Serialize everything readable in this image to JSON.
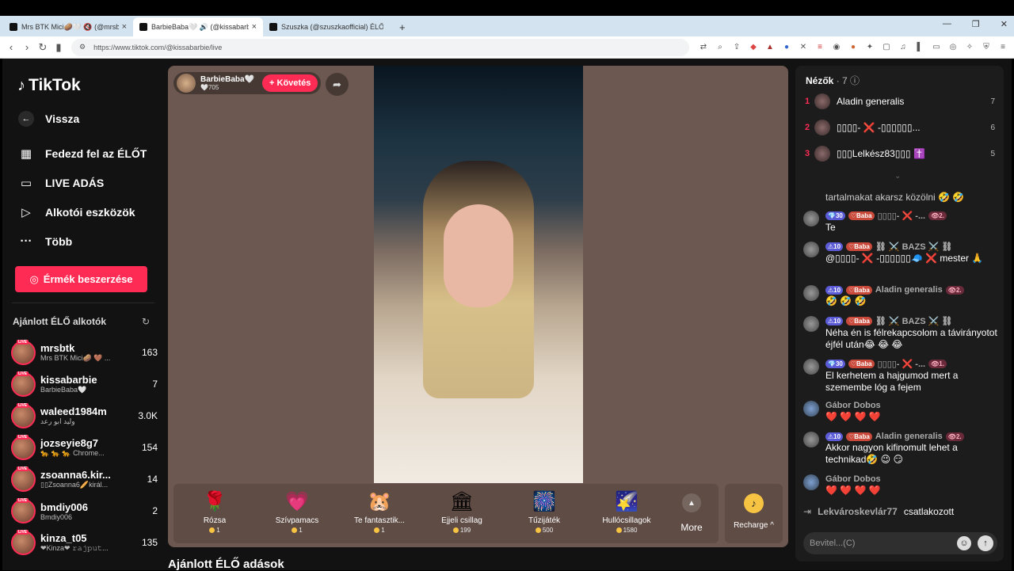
{
  "browser": {
    "tabs": [
      {
        "title": "Mrs BTK Mici🥔🤍 🔇 (@mrsbtk"
      },
      {
        "title": "BarbieBaba🤍 🔊 (@kissabarbie"
      },
      {
        "title": "Szuszka (@szuszkaofficial) ÉLŐ adás"
      }
    ],
    "new_tab": "+",
    "url": "https://www.tiktok.com/@kissabarbie/live",
    "window_controls": [
      "—",
      "❐",
      "✕"
    ]
  },
  "sidebar": {
    "logo": "TikTok",
    "back": "Vissza",
    "nav": [
      {
        "label": "Fedezd fel az ÉLŐT",
        "icon": "calendar-icon"
      },
      {
        "label": "LIVE ADÁS",
        "icon": "camera-icon"
      },
      {
        "label": "Alkotói eszközök",
        "icon": "play-icon"
      },
      {
        "label": "Több",
        "icon": "dots-icon"
      }
    ],
    "coins_button": "Érmék beszerzése",
    "section_title": "Ajánlott ÉLŐ alkotók",
    "live_badge": "LIVE",
    "creators": [
      {
        "name": "mrsbtk",
        "sub": "Mrs BTK Mici🥔 🤎 ...",
        "count": "163"
      },
      {
        "name": "kissabarbie",
        "sub": "BarbieBaba🤍",
        "count": "7"
      },
      {
        "name": "waleed1984m",
        "sub": "وليد ابو رعد",
        "count": "3.0K"
      },
      {
        "name": "jozseyie8g7",
        "sub": "🐆 🐆 🐆 Chrome...",
        "count": "154"
      },
      {
        "name": "zsoanna6.kir...",
        "sub": "▯▯Zsoanna6🥖királ...",
        "count": "14"
      },
      {
        "name": "bmdiy006",
        "sub": "Bmdiy006",
        "count": "2"
      },
      {
        "name": "kinza_t05",
        "sub": "❤Kinza❤ 𝚛𝚊𝚓𝚙𝚞𝚝...",
        "count": "135"
      }
    ]
  },
  "stream": {
    "host_name": "BarbieBaba🤍",
    "host_likes": "🤍705",
    "follow_label": "+ Követés",
    "share_icon": "share-icon",
    "gifts": [
      {
        "name": "Rózsa",
        "price": "1",
        "icon": "🌹"
      },
      {
        "name": "Szívpamacs",
        "price": "1",
        "icon": "💗"
      },
      {
        "name": "Te fantasztik...",
        "price": "1",
        "icon": "🐹"
      },
      {
        "name": "Éjjeli csillag",
        "price": "199",
        "icon": "🏛"
      },
      {
        "name": "Tűzijáték",
        "price": "500",
        "icon": "🎆"
      },
      {
        "name": "Hullócsillagok",
        "price": "1580",
        "icon": "🌠"
      }
    ],
    "more_label": "More",
    "recharge_label": "Recharge ^",
    "below_title": "Ajánlott ÉLŐ adások"
  },
  "chat": {
    "viewers_title": "Nézők",
    "viewers_count": "· 7",
    "top_viewers": [
      {
        "rank": "1",
        "name": "Aladin generalis",
        "score": "7"
      },
      {
        "rank": "2",
        "name": "▯▯▯▯- ❌ -▯▯▯▯▯▯...",
        "score": "6"
      },
      {
        "rank": "3",
        "name": "▯▯▯Lelkész83▯▯▯ ✝️",
        "score": "5"
      }
    ],
    "partial_msg": "tartalmakat akarsz közölni 🤣 🤣",
    "messages": [
      {
        "lvl": "💎30",
        "fan": "♡Baba",
        "user": "▯▯▯▯- ❌ -...",
        "rank": "👁2.",
        "text": "Te"
      },
      {
        "lvl": "⚠10",
        "fan": "♡Baba",
        "user": "⛓ ⚔️ BAZS ⚔️ ⛓",
        "rank": "",
        "text": "@▯▯▯▯- ❌ -▯▯▯▯▯▯🧢 ❌ mester 🙏"
      },
      {
        "lvl": "⚠10",
        "fan": "♡Baba",
        "user": "Aladin generalis",
        "rank": "👁2.",
        "text": "🤣 🤣 🤣"
      },
      {
        "lvl": "⚠10",
        "fan": "♡Baba",
        "user": "⛓ ⚔️ BAZS ⚔️ ⛓",
        "rank": "",
        "text": "Néha én is félrekapcsolom a távirányotot éjfél után😂 😂 😂"
      },
      {
        "lvl": "💎30",
        "fan": "♡Baba",
        "user": "▯▯▯▯- ❌ -...",
        "rank": "👁1.",
        "text": "El kerhetem a hajgumod mert a szemembe lóg a fejem"
      },
      {
        "lvl": "",
        "fan": "",
        "user": "Gábor Dobos",
        "rank": "",
        "text": "❤️ ❤️ ❤️ ❤️"
      },
      {
        "lvl": "⚠10",
        "fan": "♡Baba",
        "user": "Aladin generalis",
        "rank": "👁2.",
        "text": "Akkor nagyon kifinomult lehet a technikad🤣 😉 😏"
      },
      {
        "lvl": "",
        "fan": "",
        "user": "Gábor Dobos",
        "rank": "",
        "text": "❤️ ❤️ ❤️ ❤️"
      }
    ],
    "joined_user": "Lekvároskevlár77",
    "joined_text": "csatlakozott",
    "input_placeholder": "Bevitel...(C)"
  }
}
